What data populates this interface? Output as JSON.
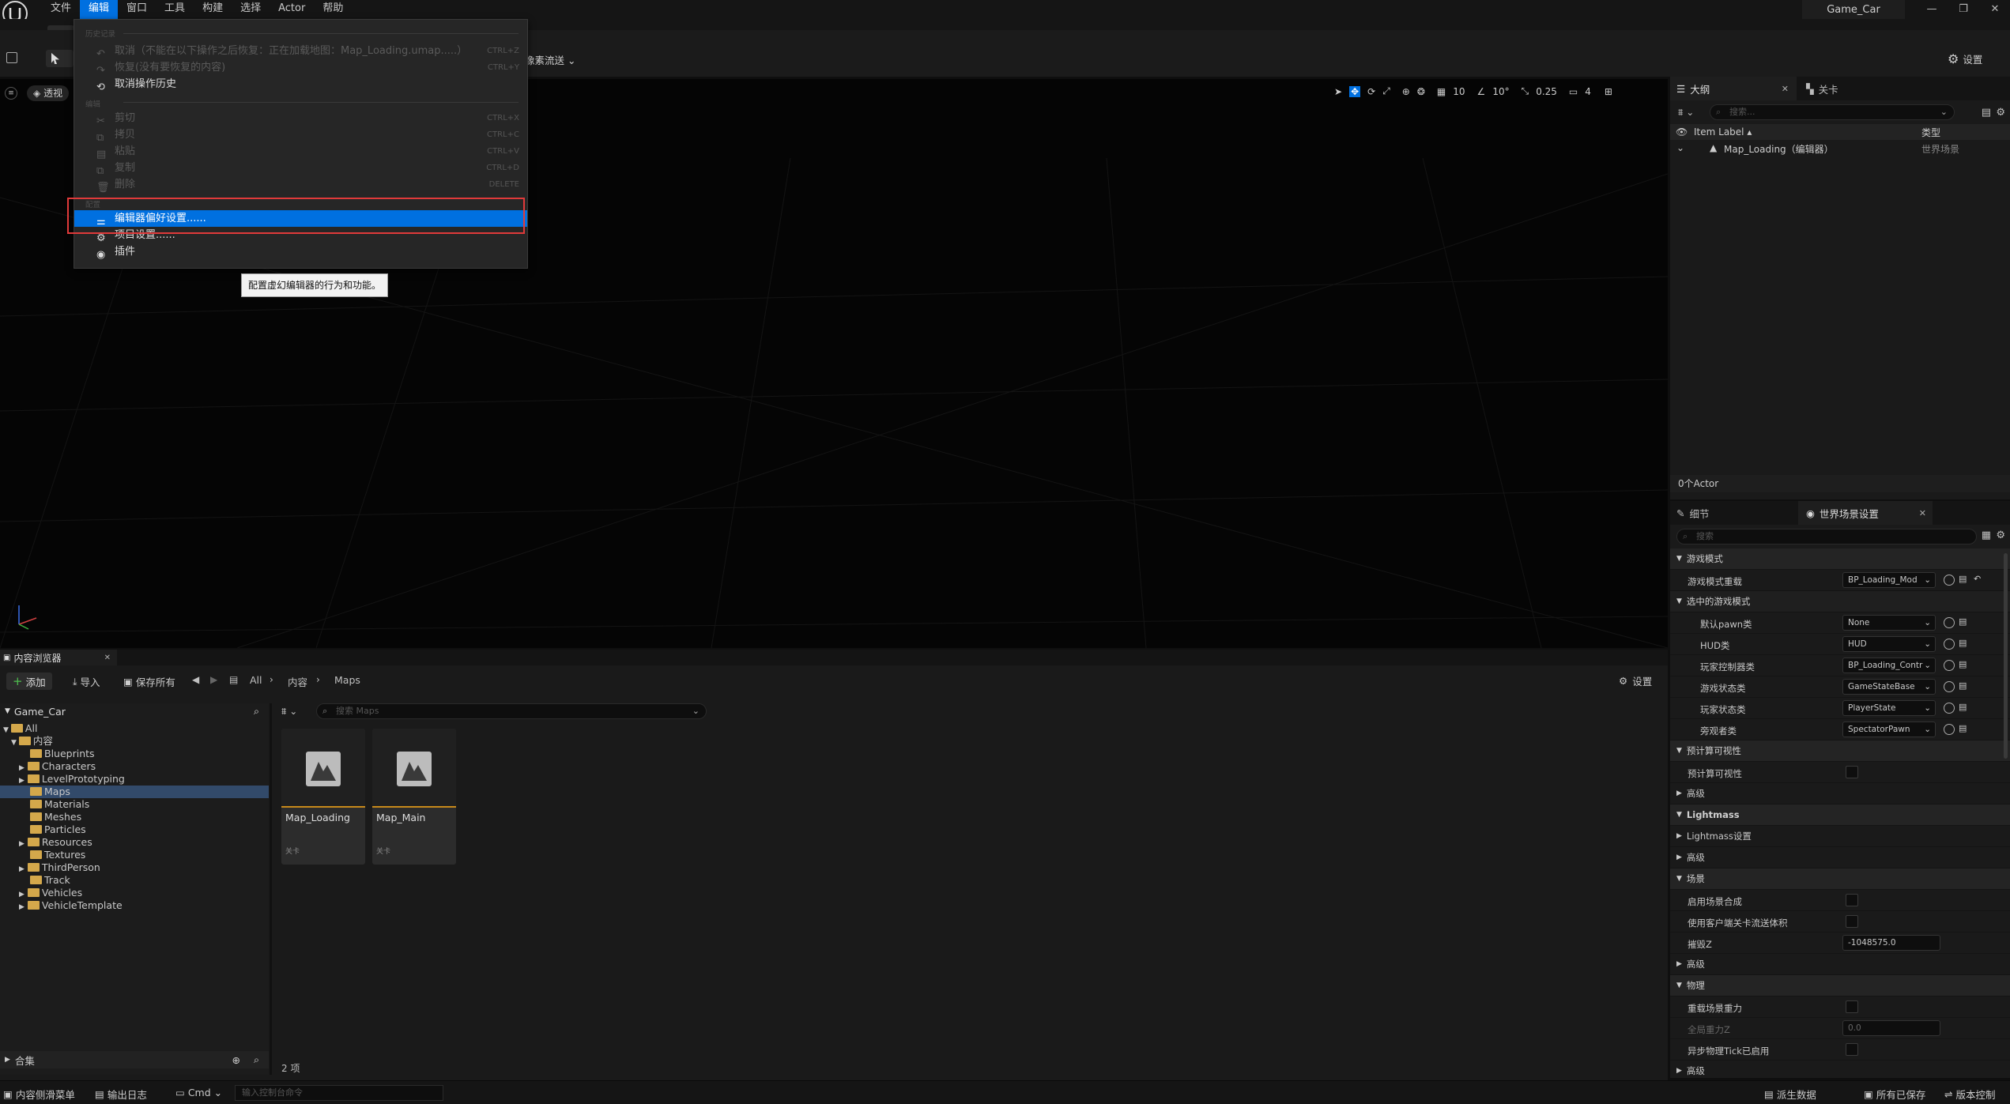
{
  "window": {
    "menubar": [
      "文件",
      "编辑",
      "窗口",
      "工具",
      "构建",
      "选择",
      "Actor",
      "帮助"
    ],
    "active_menu": "编辑",
    "project_name": "Game_Car"
  },
  "toolbar": {
    "streaming_label": "像素流送",
    "settings_label": "设置"
  },
  "viewport": {
    "view_mode": "透视",
    "grid_snap": "10",
    "rot_snap": "10°",
    "scale_snap": "0.25",
    "camera_speed": "4"
  },
  "edit_menu": {
    "section_history": "历史记录",
    "undo": "取消（不能在以下操作之后恢复：正在加载地图：Map_Loading.umap.....）",
    "undo_shortcut": "CTRL+Z",
    "redo": "恢复(没有要恢复的内容)",
    "redo_shortcut": "CTRL+Y",
    "undo_history": "取消操作历史",
    "section_edit": "编辑",
    "cut": "剪切",
    "cut_shortcut": "CTRL+X",
    "copy": "拷贝",
    "copy_shortcut": "CTRL+C",
    "paste": "粘贴",
    "paste_shortcut": "CTRL+V",
    "duplicate": "复制",
    "duplicate_shortcut": "CTRL+D",
    "delete": "删除",
    "delete_shortcut": "DELETE",
    "section_config": "配置",
    "editor_prefs": "编辑器偏好设置......",
    "project_settings": "项目设置......",
    "plugins": "插件"
  },
  "tooltip": "配置虚幻编辑器的行为和功能。",
  "outliner": {
    "tab": "大纲",
    "tab2": "关卡",
    "search_placeholder": "搜索...",
    "col_label": "Item Label",
    "col_type": "类型",
    "row_label": "Map_Loading（编辑器）",
    "row_type": "世界场景",
    "footer": "0个Actor"
  },
  "details": {
    "tab": "细节",
    "tab2": "世界场景设置",
    "search_placeholder": "搜索",
    "rows": {
      "cat_gamemode": "游戏模式",
      "gm_override": "游戏模式重载",
      "gm_override_val": "BP_Loading_Mod",
      "cat_selected": "选中的游戏模式",
      "pawn": "默认pawn类",
      "pawn_val": "None",
      "hud": "HUD类",
      "hud_val": "HUD",
      "pc": "玩家控制器类",
      "pc_val": "BP_Loading_Contr",
      "gs": "游戏状态类",
      "gs_val": "GameStateBase",
      "ps": "玩家状态类",
      "ps_val": "PlayerState",
      "spec": "旁观者类",
      "spec_val": "SpectatorPawn",
      "cat_precomp": "预计算可视性",
      "precomp": "预计算可视性",
      "adv1": "高级",
      "cat_lightmass": "Lightmass",
      "lightmass_settings": "Lightmass设置",
      "adv2": "高级",
      "cat_world": "场景",
      "world_comp": "启用场景合成",
      "client_stream": "使用客户端关卡流送体积",
      "kill_z": "摧毁Z",
      "kill_z_val": "-1048575.0",
      "adv3": "高级",
      "cat_physics": "物理",
      "override_gravity": "重载场景重力",
      "global_gravity": "全局重力Z",
      "global_gravity_val": "0.0",
      "async_tick": "异步物理Tick已启用",
      "adv4": "高级"
    }
  },
  "content_browser": {
    "tab": "内容浏览器",
    "add": "添加",
    "import": "导入",
    "save_all": "保存所有",
    "crumb_all": "All",
    "crumb_content": "内容",
    "crumb_maps": "Maps",
    "settings": "设置",
    "tree_root": "Game_Car",
    "search_placeholder": "搜索 Maps",
    "tree": [
      "All",
      "内容",
      "Blueprints",
      "Characters",
      "LevelPrototyping",
      "Maps",
      "Materials",
      "Meshes",
      "Particles",
      "Resources",
      "Textures",
      "ThirdPerson",
      "Track",
      "Vehicles",
      "VehicleTemplate"
    ],
    "collections": "合集",
    "assets": [
      {
        "name": "Map_Loading",
        "type": "关卡"
      },
      {
        "name": "Map_Main",
        "type": "关卡"
      }
    ],
    "item_count": "2 项"
  },
  "statusbar": {
    "drawer": "内容侧滑菜单",
    "output_log": "输出日志",
    "cmd": "Cmd",
    "console_placeholder": "输入控制台命令",
    "derived_data": "派生数据",
    "all_saved": "所有已保存",
    "source_control": "版本控制"
  }
}
